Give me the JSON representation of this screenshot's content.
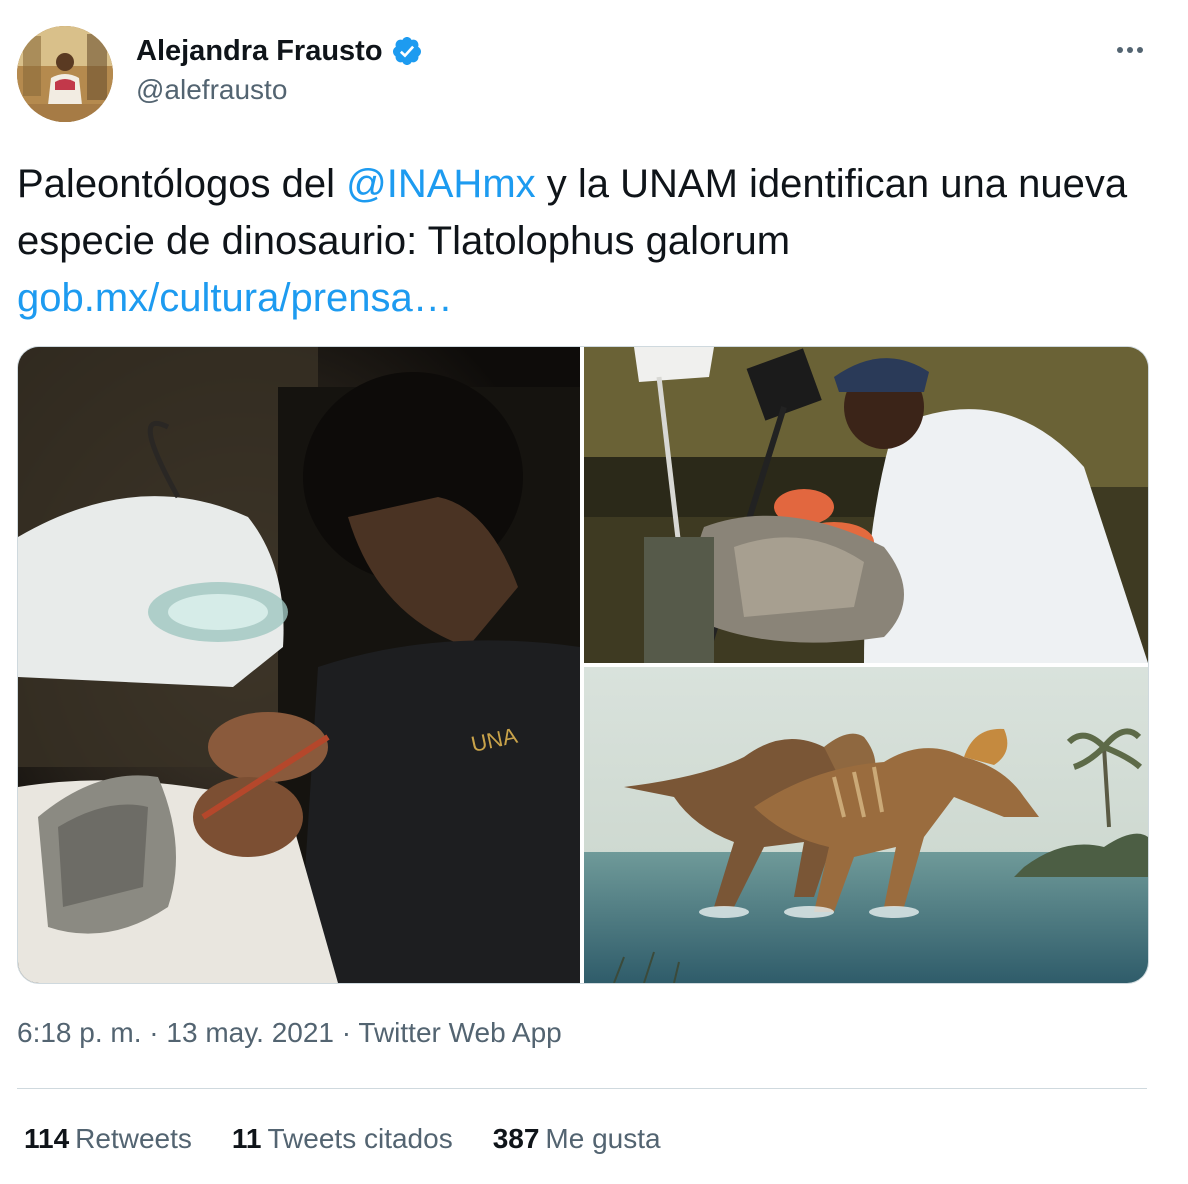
{
  "author": {
    "display_name": "Alejandra Frausto",
    "handle": "@alefrausto",
    "verified": true,
    "avatar_icon": "profile-photo"
  },
  "tweet": {
    "text_before": "Paleontólogos del ",
    "mention": "@INAHmx",
    "text_after": " y la UNAM identifican una nueva especie de dinosaurio: Tlatolophus galorum",
    "link": "gob.mx/cultura/prensa…"
  },
  "media": {
    "images": [
      {
        "icon": "photo-paleontologist-magnifier-lamp"
      },
      {
        "icon": "photo-paleontologist-fossil-lab"
      },
      {
        "icon": "illustration-tlatolophus-dinosaurs"
      }
    ]
  },
  "meta": {
    "time": "6:18 p. m.",
    "sep1": " · ",
    "date": "13 may. 2021",
    "sep2": " · ",
    "source": "Twitter Web App"
  },
  "stats": {
    "retweets_count": "114",
    "retweets_label": "Retweets",
    "quotes_count": "11",
    "quotes_label": "Tweets citados",
    "likes_count": "387",
    "likes_label": "Me gusta"
  },
  "colors": {
    "link": "#1d9bf0",
    "secondary_text": "#536471",
    "primary_text": "#0f1419",
    "border": "#cfd9de"
  },
  "icons": {
    "verified": "verified-badge-icon",
    "more": "more-options-icon"
  }
}
